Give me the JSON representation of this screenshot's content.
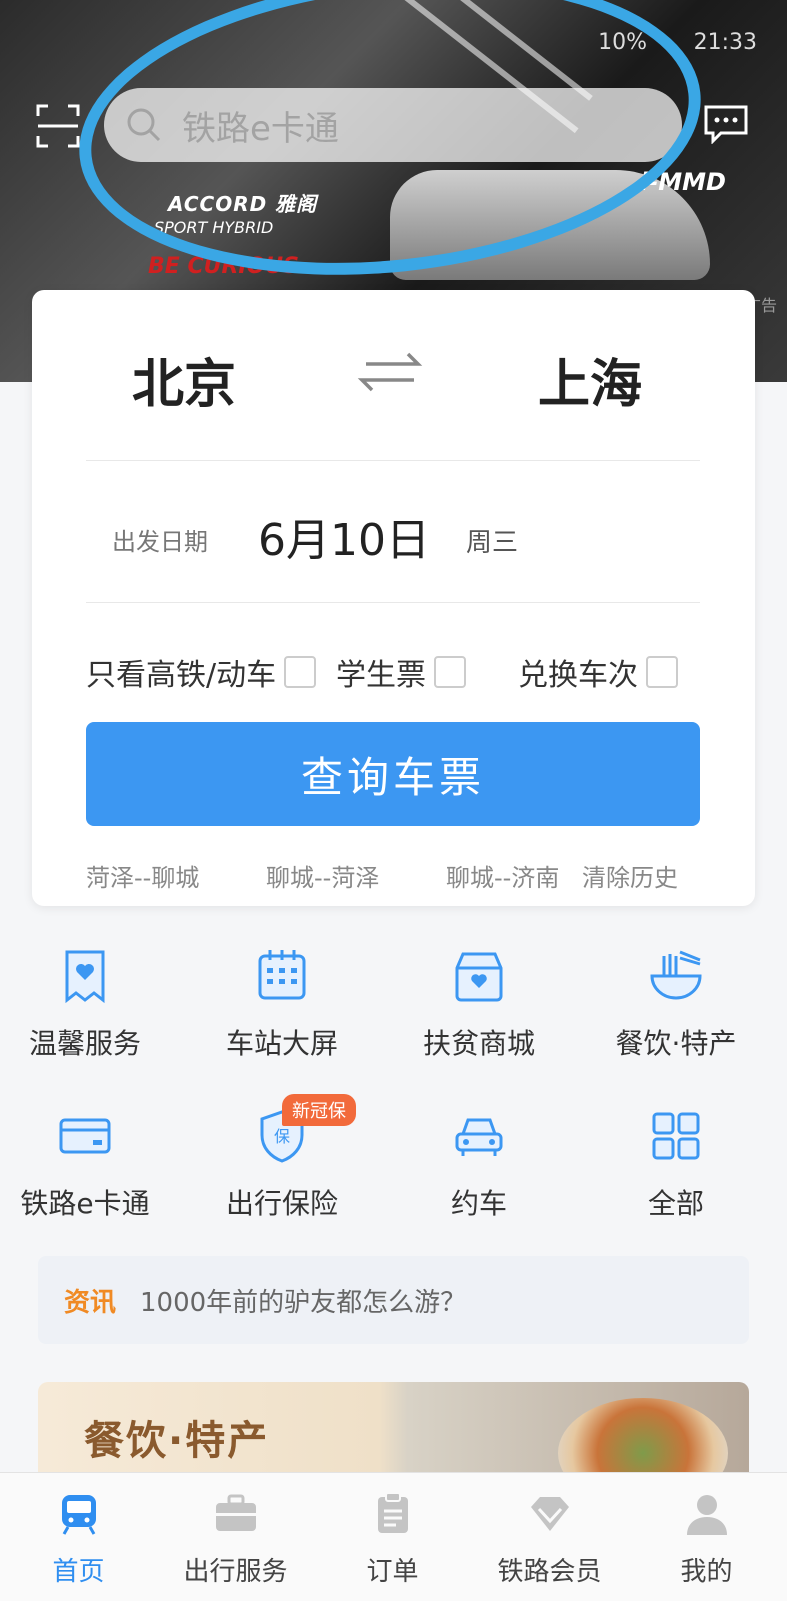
{
  "status_bar": {
    "battery": "10%",
    "time": "21:33"
  },
  "search": {
    "placeholder": "铁路e卡通",
    "scan_icon": "scan-icon",
    "message_icon": "message-icon"
  },
  "banner": {
    "car_model": "ACCORD 雅阁",
    "car_variant": "SPORT HYBRID",
    "slogan": "BE CURIOUS",
    "brand": "i-MMD",
    "ad_label": "广告"
  },
  "ticket": {
    "from_city": "北京",
    "to_city": "上海",
    "date_label": "出发日期",
    "date_value": "6月10日",
    "weekday": "周三",
    "options": [
      "只看高铁/动车",
      "学生票",
      "兑换车次"
    ],
    "query_button": "查询车票",
    "history": [
      "菏泽--聊城",
      "聊城--菏泽",
      "聊城--济南"
    ],
    "clear_history": "清除历史"
  },
  "services": [
    {
      "label": "温馨服务",
      "icon": "heart-card-icon"
    },
    {
      "label": "车站大屏",
      "icon": "calendar-grid-icon"
    },
    {
      "label": "扶贫商城",
      "icon": "shop-icon"
    },
    {
      "label": "餐饮·特产",
      "icon": "noodle-bowl-icon"
    },
    {
      "label": "铁路e卡通",
      "icon": "card-icon"
    },
    {
      "label": "出行保险",
      "icon": "shield-icon"
    },
    {
      "label": "约车",
      "icon": "car-icon"
    },
    {
      "label": "全部",
      "icon": "grid-icon"
    }
  ],
  "insurance_badge": "新冠保",
  "news": {
    "tag": "资讯",
    "text": "1000年前的驴友都怎么游？"
  },
  "promo": {
    "title": "餐饮·特产"
  },
  "tabs": [
    {
      "label": "首页",
      "icon": "train-icon",
      "active": true
    },
    {
      "label": "出行服务",
      "icon": "briefcase-icon",
      "active": false
    },
    {
      "label": "订单",
      "icon": "clipboard-icon",
      "active": false
    },
    {
      "label": "铁路会员",
      "icon": "diamond-icon",
      "active": false
    },
    {
      "label": "我的",
      "icon": "user-icon",
      "active": false
    }
  ],
  "colors": {
    "primary": "#3c97f2",
    "accent": "#f08a24",
    "annotation": "#3aa7e5"
  }
}
